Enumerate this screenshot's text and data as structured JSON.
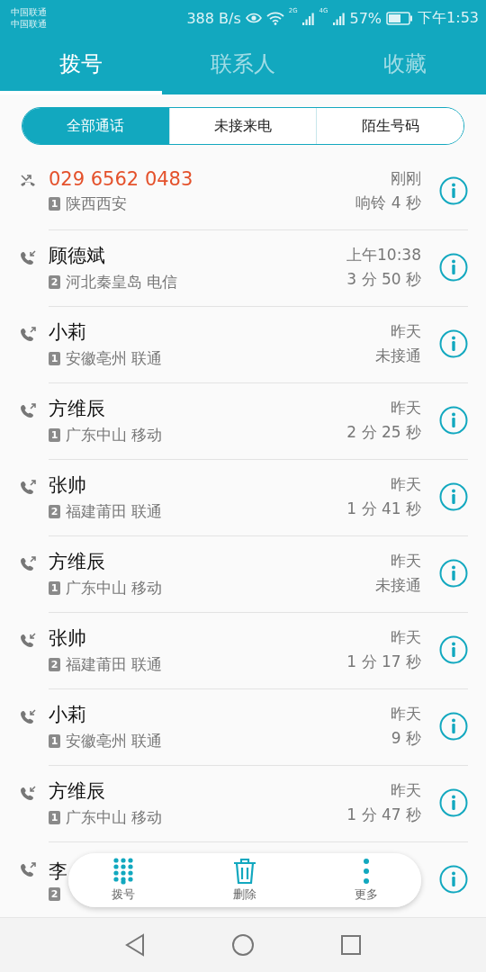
{
  "status_bar": {
    "carriers": [
      "中国联通",
      "中国联通"
    ],
    "speed": "388 B/s",
    "net_1": "2G",
    "net_2": "4G",
    "battery": "57%",
    "time": "下午1:53"
  },
  "tabs": [
    {
      "label": "拨号",
      "selected": true
    },
    {
      "label": "联系人",
      "selected": false
    },
    {
      "label": "收藏",
      "selected": false
    }
  ],
  "filters": [
    {
      "label": "全部通话",
      "selected": true
    },
    {
      "label": "未接来电",
      "selected": false
    },
    {
      "label": "陌生号码",
      "selected": false
    }
  ],
  "calls": [
    {
      "kind": "missed",
      "name": "029 6562 0483",
      "sim": "1",
      "location": "陕西西安",
      "time": "刚刚",
      "detail": "响铃 4 秒"
    },
    {
      "kind": "incoming",
      "name": "顾德斌",
      "sim": "2",
      "location": "河北秦皇岛 电信",
      "time": "上午10:38",
      "detail": "3 分 50 秒"
    },
    {
      "kind": "outgoing",
      "name": "小莉",
      "sim": "1",
      "location": "安徽亳州 联通",
      "time": "昨天",
      "detail": "未接通"
    },
    {
      "kind": "outgoing",
      "name": "方维辰",
      "sim": "1",
      "location": "广东中山 移动",
      "time": "昨天",
      "detail": "2 分 25 秒"
    },
    {
      "kind": "outgoing",
      "name": "张帅",
      "sim": "2",
      "location": "福建莆田 联通",
      "time": "昨天",
      "detail": "1 分 41 秒"
    },
    {
      "kind": "outgoing",
      "name": "方维辰",
      "sim": "1",
      "location": "广东中山 移动",
      "time": "昨天",
      "detail": "未接通"
    },
    {
      "kind": "incoming",
      "name": "张帅",
      "sim": "2",
      "location": "福建莆田 联通",
      "time": "昨天",
      "detail": "1 分 17 秒"
    },
    {
      "kind": "incoming",
      "name": "小莉",
      "sim": "1",
      "location": "安徽亳州 联通",
      "time": "昨天",
      "detail": "9 秒"
    },
    {
      "kind": "incoming",
      "name": "方维辰",
      "sim": "1",
      "location": "广东中山 移动",
      "time": "昨天",
      "detail": "1 分 47 秒"
    },
    {
      "kind": "outgoing",
      "name": "李",
      "sim": "2"
    }
  ],
  "toolbar": [
    {
      "kind": "dialpad",
      "label": "拨号"
    },
    {
      "kind": "delete",
      "label": "删除"
    },
    {
      "kind": "more",
      "label": "更多"
    }
  ]
}
